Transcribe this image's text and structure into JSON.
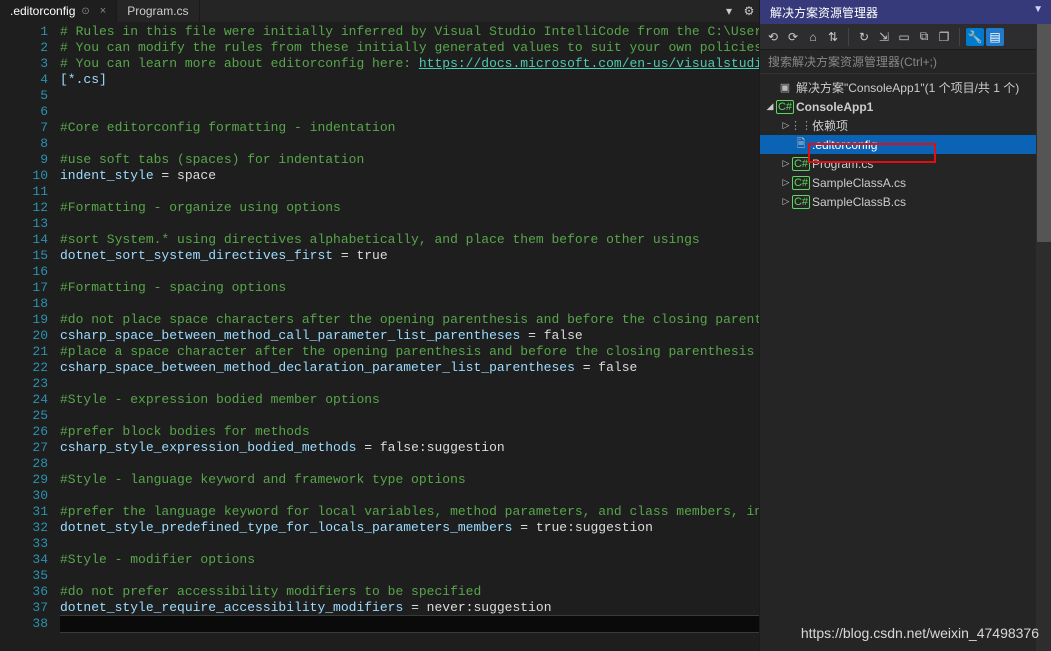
{
  "tabs": {
    "items": [
      {
        "label": ".editorconfig",
        "active": true,
        "pinned": true
      },
      {
        "label": "Program.cs",
        "active": false,
        "pinned": false
      }
    ]
  },
  "code": {
    "lines": [
      {
        "n": 1,
        "kind": "comment",
        "text": "# Rules in this file were initially inferred by Visual Studio IntelliCode from the C:\\Users\\F"
      },
      {
        "n": 2,
        "kind": "comment",
        "text": "# You can modify the rules from these initially generated values to suit your own policies"
      },
      {
        "n": 3,
        "kind": "commentlink",
        "prefix": "# You can learn more about editorconfig here: ",
        "link": "https://docs.microsoft.com/en-us/visualstudio/i"
      },
      {
        "n": 4,
        "kind": "cyan",
        "text": "[*.cs]"
      },
      {
        "n": 5,
        "kind": "blank",
        "text": ""
      },
      {
        "n": 6,
        "kind": "blank",
        "text": ""
      },
      {
        "n": 7,
        "kind": "comment",
        "text": "#Core editorconfig formatting - indentation"
      },
      {
        "n": 8,
        "kind": "blank",
        "text": ""
      },
      {
        "n": 9,
        "kind": "comment",
        "text": "#use soft tabs (spaces) for indentation"
      },
      {
        "n": 10,
        "kind": "assign",
        "key": "indent_style",
        "eq": " = ",
        "val": "space"
      },
      {
        "n": 11,
        "kind": "blank",
        "text": ""
      },
      {
        "n": 12,
        "kind": "comment",
        "text": "#Formatting - organize using options"
      },
      {
        "n": 13,
        "kind": "blank",
        "text": ""
      },
      {
        "n": 14,
        "kind": "comment",
        "text": "#sort System.* using directives alphabetically, and place them before other usings"
      },
      {
        "n": 15,
        "kind": "assign",
        "key": "dotnet_sort_system_directives_first",
        "eq": " = ",
        "val": "true"
      },
      {
        "n": 16,
        "kind": "blank",
        "text": ""
      },
      {
        "n": 17,
        "kind": "comment",
        "text": "#Formatting - spacing options"
      },
      {
        "n": 18,
        "kind": "blank",
        "text": ""
      },
      {
        "n": 19,
        "kind": "comment",
        "text": "#do not place space characters after the opening parenthesis and before the closing parenthes"
      },
      {
        "n": 20,
        "kind": "assign",
        "key": "csharp_space_between_method_call_parameter_list_parentheses",
        "eq": " = ",
        "val": "false"
      },
      {
        "n": 21,
        "kind": "comment",
        "text": "#place a space character after the opening parenthesis and before the closing parenthesis of "
      },
      {
        "n": 22,
        "kind": "assign",
        "key": "csharp_space_between_method_declaration_parameter_list_parentheses",
        "eq": " = ",
        "val": "false"
      },
      {
        "n": 23,
        "kind": "blank",
        "text": ""
      },
      {
        "n": 24,
        "kind": "comment",
        "text": "#Style - expression bodied member options"
      },
      {
        "n": 25,
        "kind": "blank",
        "text": ""
      },
      {
        "n": 26,
        "kind": "comment",
        "text": "#prefer block bodies for methods"
      },
      {
        "n": 27,
        "kind": "assign",
        "key": "csharp_style_expression_bodied_methods",
        "eq": " = ",
        "val": "false:suggestion"
      },
      {
        "n": 28,
        "kind": "blank",
        "text": ""
      },
      {
        "n": 29,
        "kind": "comment",
        "text": "#Style - language keyword and framework type options"
      },
      {
        "n": 30,
        "kind": "blank",
        "text": ""
      },
      {
        "n": 31,
        "kind": "comment",
        "text": "#prefer the language keyword for local variables, method parameters, and class members, inste"
      },
      {
        "n": 32,
        "kind": "assign",
        "key": "dotnet_style_predefined_type_for_locals_parameters_members",
        "eq": " = ",
        "val": "true:suggestion"
      },
      {
        "n": 33,
        "kind": "blank",
        "text": ""
      },
      {
        "n": 34,
        "kind": "comment",
        "text": "#Style - modifier options"
      },
      {
        "n": 35,
        "kind": "blank",
        "text": ""
      },
      {
        "n": 36,
        "kind": "comment",
        "text": "#do not prefer accessibility modifiers to be specified"
      },
      {
        "n": 37,
        "kind": "assign",
        "key": "dotnet_style_require_accessibility_modifiers",
        "eq": " = ",
        "val": "never:suggestion"
      },
      {
        "n": 38,
        "kind": "cursor",
        "text": ""
      }
    ]
  },
  "solution_panel": {
    "title": "解决方案资源管理器",
    "search_placeholder": "搜索解决方案资源管理器(Ctrl+;)",
    "toolbar_icons": [
      "back-icon",
      "forward-icon",
      "home-icon",
      "sync-icon",
      "sep",
      "refresh-icon",
      "collapse-icon",
      "show-all-icon",
      "copy-icon",
      "stack-icon",
      "sep",
      "wrench-icon",
      "prop-icon"
    ],
    "tree": [
      {
        "depth": 0,
        "arrow": "none",
        "icon": "sln",
        "label": "解决方案\"ConsoleApp1\"(1 个项目/共 1 个)",
        "bold": false,
        "sel": false
      },
      {
        "depth": 0,
        "arrow": "open",
        "icon": "proj",
        "label": "ConsoleApp1",
        "bold": true,
        "sel": false
      },
      {
        "depth": 1,
        "arrow": "closed",
        "icon": "dep",
        "label": "依赖项",
        "bold": false,
        "sel": false
      },
      {
        "depth": 1,
        "arrow": "none",
        "icon": "file",
        "label": ".editorconfig",
        "bold": false,
        "sel": true
      },
      {
        "depth": 1,
        "arrow": "closed",
        "icon": "cs",
        "label": "Program.cs",
        "bold": false,
        "sel": false
      },
      {
        "depth": 1,
        "arrow": "closed",
        "icon": "cs",
        "label": "SampleClassA.cs",
        "bold": false,
        "sel": false
      },
      {
        "depth": 1,
        "arrow": "closed",
        "icon": "cs",
        "label": "SampleClassB.cs",
        "bold": false,
        "sel": false
      }
    ]
  },
  "watermark": "https://blog.csdn.net/weixin_47498376"
}
